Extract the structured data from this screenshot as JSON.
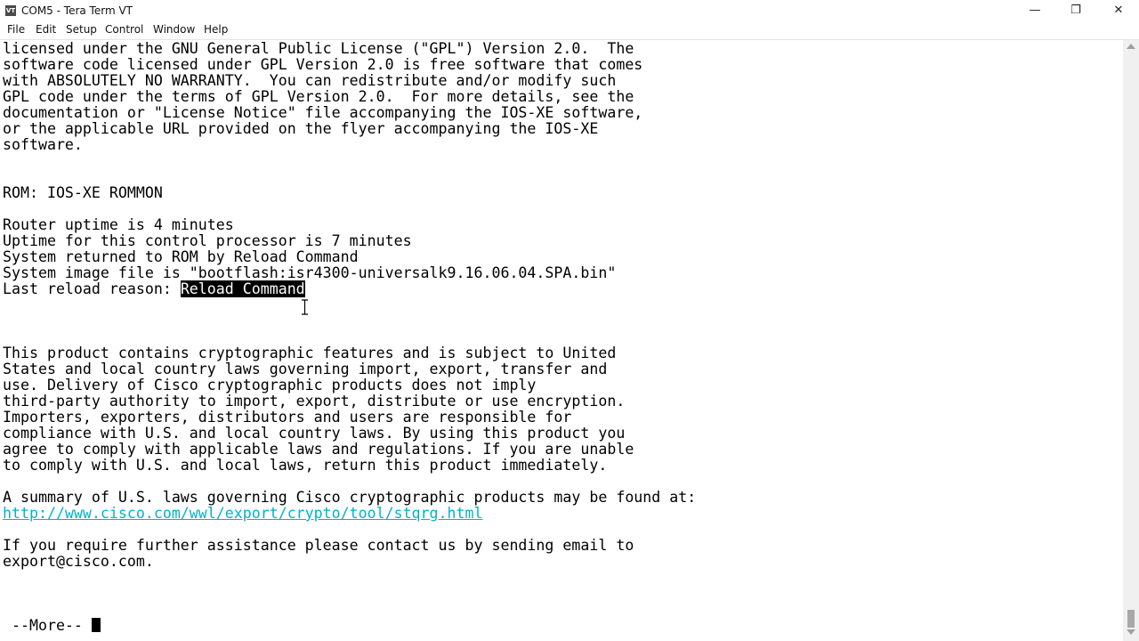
{
  "window": {
    "title": "COM5 - Tera Term VT",
    "icon_text": "VT",
    "minimize_glyph": "—",
    "maximize_glyph": "❐",
    "close_glyph": "✕"
  },
  "menu": [
    "File",
    "Edit",
    "Setup",
    "Control",
    "Window",
    "Help"
  ],
  "terminal": {
    "lines": [
      "licensed under the GNU General Public License (\"GPL\") Version 2.0.  The",
      "software code licensed under GPL Version 2.0 is free software that comes",
      "with ABSOLUTELY NO WARRANTY.  You can redistribute and/or modify such",
      "GPL code under the terms of GPL Version 2.0.  For more details, see the",
      "documentation or \"License Notice\" file accompanying the IOS-XE software,",
      "or the applicable URL provided on the flyer accompanying the IOS-XE",
      "software.",
      "",
      "",
      "ROM: IOS-XE ROMMON",
      "",
      "Router uptime is 4 minutes",
      "Uptime for this control processor is 7 minutes",
      "System returned to ROM by Reload Command",
      "System image file is \"bootflash:isr4300-universalk9.16.06.04.SPA.bin\"",
      "",
      "",
      "",
      "",
      "This product contains cryptographic features and is subject to United",
      "States and local country laws governing import, export, transfer and",
      "use. Delivery of Cisco cryptographic products does not imply",
      "third-party authority to import, export, distribute or use encryption.",
      "Importers, exporters, distributors and users are responsible for",
      "compliance with U.S. and local country laws. By using this product you",
      "agree to comply with applicable laws and regulations. If you are unable",
      "to comply with U.S. and local laws, return this product immediately.",
      "",
      "A summary of U.S. laws governing Cisco cryptographic products may be found at:",
      "",
      "",
      "If you require further assistance please contact us by sending email to",
      "export@cisco.com."
    ],
    "reload_prefix": "Last reload reason: ",
    "reload_selected": "Reload Command",
    "url": "http://www.cisco.com/wwl/export/crypto/tool/stqrg.html",
    "more_prompt": " --More-- "
  }
}
